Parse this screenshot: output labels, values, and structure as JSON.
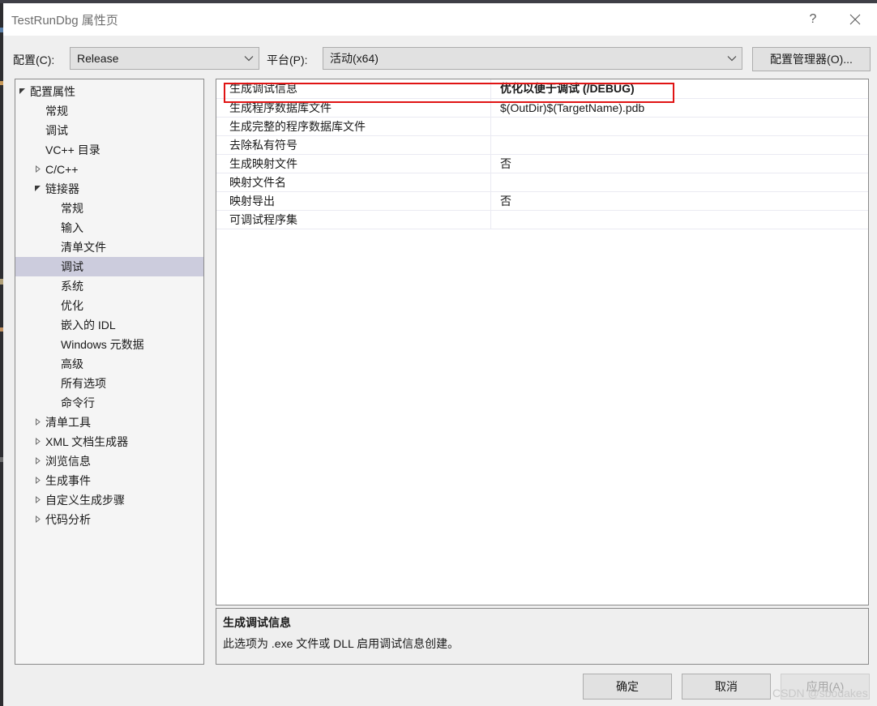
{
  "window": {
    "title": "TestRunDbg 属性页",
    "help_icon": "help-question-icon",
    "help_label": "?",
    "close_icon": "close-x-icon"
  },
  "config_bar": {
    "config_label": "配置(C):",
    "config_value": "Release",
    "platform_label": "平台(P):",
    "platform_value": "活动(x64)",
    "config_manager_button": "配置管理器(O)...",
    "chevron_icon": "chevron-down-icon"
  },
  "tree": {
    "expanded_icon": "▲",
    "collapsed_icon": "▷",
    "items": [
      {
        "label": "配置属性",
        "depth": 0,
        "state": "expanded",
        "selected": false
      },
      {
        "label": "常规",
        "depth": 1,
        "state": "leaf",
        "selected": false
      },
      {
        "label": "调试",
        "depth": 1,
        "state": "leaf",
        "selected": false
      },
      {
        "label": "VC++ 目录",
        "depth": 1,
        "state": "leaf",
        "selected": false
      },
      {
        "label": "C/C++",
        "depth": 1,
        "state": "collapsed",
        "selected": false
      },
      {
        "label": "链接器",
        "depth": 1,
        "state": "expanded",
        "selected": false
      },
      {
        "label": "常规",
        "depth": 2,
        "state": "leaf",
        "selected": false
      },
      {
        "label": "输入",
        "depth": 2,
        "state": "leaf",
        "selected": false
      },
      {
        "label": "清单文件",
        "depth": 2,
        "state": "leaf",
        "selected": false
      },
      {
        "label": "调试",
        "depth": 2,
        "state": "leaf",
        "selected": true
      },
      {
        "label": "系统",
        "depth": 2,
        "state": "leaf",
        "selected": false
      },
      {
        "label": "优化",
        "depth": 2,
        "state": "leaf",
        "selected": false
      },
      {
        "label": "嵌入的 IDL",
        "depth": 2,
        "state": "leaf",
        "selected": false
      },
      {
        "label": "Windows 元数据",
        "depth": 2,
        "state": "leaf",
        "selected": false
      },
      {
        "label": "高级",
        "depth": 2,
        "state": "leaf",
        "selected": false
      },
      {
        "label": "所有选项",
        "depth": 2,
        "state": "leaf",
        "selected": false
      },
      {
        "label": "命令行",
        "depth": 2,
        "state": "leaf",
        "selected": false
      },
      {
        "label": "清单工具",
        "depth": 1,
        "state": "collapsed",
        "selected": false
      },
      {
        "label": "XML 文档生成器",
        "depth": 1,
        "state": "collapsed",
        "selected": false
      },
      {
        "label": "浏览信息",
        "depth": 1,
        "state": "collapsed",
        "selected": false
      },
      {
        "label": "生成事件",
        "depth": 1,
        "state": "collapsed",
        "selected": false
      },
      {
        "label": "自定义生成步骤",
        "depth": 1,
        "state": "collapsed",
        "selected": false
      },
      {
        "label": "代码分析",
        "depth": 1,
        "state": "collapsed",
        "selected": false
      }
    ]
  },
  "properties": {
    "highlight_color": "#e01414",
    "rows": [
      {
        "name": "生成调试信息",
        "value": "优化以便于调试 (/DEBUG)",
        "highlighted": true
      },
      {
        "name": "生成程序数据库文件",
        "value": "$(OutDir)$(TargetName).pdb",
        "highlighted": false
      },
      {
        "name": "生成完整的程序数据库文件",
        "value": "",
        "highlighted": false
      },
      {
        "name": "去除私有符号",
        "value": "",
        "highlighted": false
      },
      {
        "name": "生成映射文件",
        "value": "否",
        "highlighted": false
      },
      {
        "name": "映射文件名",
        "value": "",
        "highlighted": false
      },
      {
        "name": "映射导出",
        "value": "否",
        "highlighted": false
      },
      {
        "name": "可调试程序集",
        "value": "",
        "highlighted": false
      }
    ]
  },
  "description": {
    "title": "生成调试信息",
    "body": "此选项为 .exe 文件或 DLL 启用调试信息创建。"
  },
  "buttons": {
    "ok": "确定",
    "cancel": "取消",
    "apply": "应用(A)"
  },
  "watermark": "CSDN @sbodakes"
}
